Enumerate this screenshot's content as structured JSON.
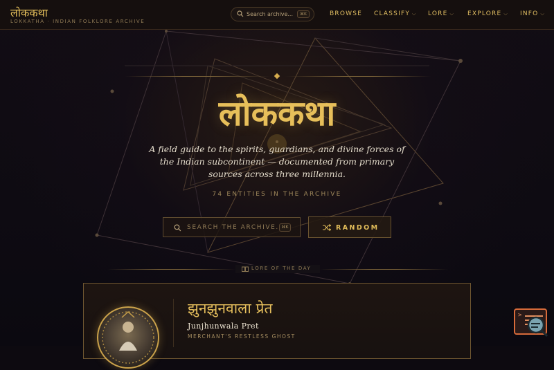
{
  "header": {
    "logo": "लोककथा",
    "subtitle": "LOKKATHA · INDIAN FOLKLORE ARCHIVE",
    "search_placeholder": "Search archive...",
    "search_shortcut": "⌘K",
    "nav": [
      {
        "label": "BROWSE",
        "has_dropdown": false
      },
      {
        "label": "CLASSIFY",
        "has_dropdown": true
      },
      {
        "label": "LORE",
        "has_dropdown": true
      },
      {
        "label": "EXPLORE",
        "has_dropdown": true
      },
      {
        "label": "INFO",
        "has_dropdown": true
      }
    ]
  },
  "hero": {
    "title": "लोककथा",
    "tagline": "A field guide to the spirits, guardians, and divine forces of the Indian subcontinent — documented from primary sources across three millennia.",
    "count_text": "74 ENTITIES IN THE ARCHIVE",
    "search_placeholder": "SEARCH THE ARCHIVE...",
    "search_shortcut": "⌘K",
    "random_label": "RANDOM"
  },
  "lore_of_the_day": {
    "label": "LORE OF THE DAY",
    "card": {
      "devanagari": "झुनझुनवाला प्रेत",
      "name": "Junjhunwala Pret",
      "type": "MERCHANT'S RESTLESS GHOST"
    }
  },
  "icons": {
    "header_search": "search-icon",
    "hero_search": "search-icon",
    "random": "shuffle-icon",
    "lore": "book-icon",
    "widget": "terminal-search-icon"
  },
  "colors": {
    "accent_gold": "#e2bd5a",
    "background": "#0d0a10",
    "widget_orange": "#d86b3a"
  }
}
